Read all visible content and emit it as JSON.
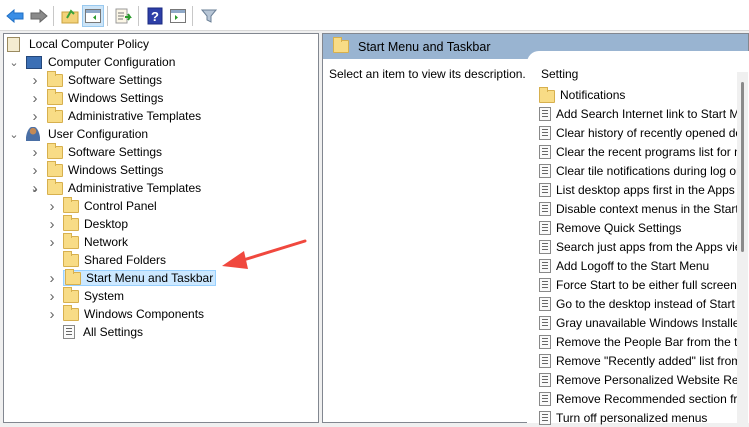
{
  "toolbar": {
    "buttons": [
      "back-arrow-icon",
      "forward-arrow-icon",
      "up-folder-icon",
      "show-hide-console-tree-icon",
      "export-list-icon",
      "help-icon",
      "show-hide-action-pane-icon",
      "filter-icon"
    ]
  },
  "tree": {
    "root": "Local Computer Policy",
    "computer_config": "Computer Configuration",
    "cc_children": [
      "Software Settings",
      "Windows Settings",
      "Administrative Templates"
    ],
    "user_config": "User Configuration",
    "uc_children": [
      "Software Settings",
      "Windows Settings",
      "Administrative Templates"
    ],
    "admin_children": [
      "Control Panel",
      "Desktop",
      "Network",
      "Shared Folders",
      "Start Menu and Taskbar",
      "System",
      "Windows Components",
      "All Settings"
    ],
    "selected": "Start Menu and Taskbar"
  },
  "right": {
    "header": "Start Menu and Taskbar",
    "description": "Select an item to view its description.",
    "column": "Setting",
    "items": [
      "Notifications",
      "Add Search Internet link to Start Menu",
      "Clear history of recently opened documents on exit",
      "Clear the recent programs list for new users",
      "Clear tile notifications during log on",
      "List desktop apps first in the Apps view",
      "Disable context menus in the Start Menu",
      "Remove Quick Settings",
      "Search just apps from the Apps view",
      "Add Logoff to the Start Menu",
      "Force Start to be either full screen size or menu size",
      "Go to the desktop instead of Start when signing in",
      "Gray unavailable Windows Installer programs Start Menu shortcuts",
      "Remove the People Bar from the taskbar",
      "Remove \"Recently added\" list from Start Menu",
      "Remove Personalized Website Recommendations from the Recommended section in the Start Menu",
      "Remove Recommended section from Start Menu",
      "Turn off personalized menus"
    ]
  },
  "colors": {
    "header": "#99b4d1",
    "selection": "#cce8ff",
    "arrow": "#f0483e"
  }
}
